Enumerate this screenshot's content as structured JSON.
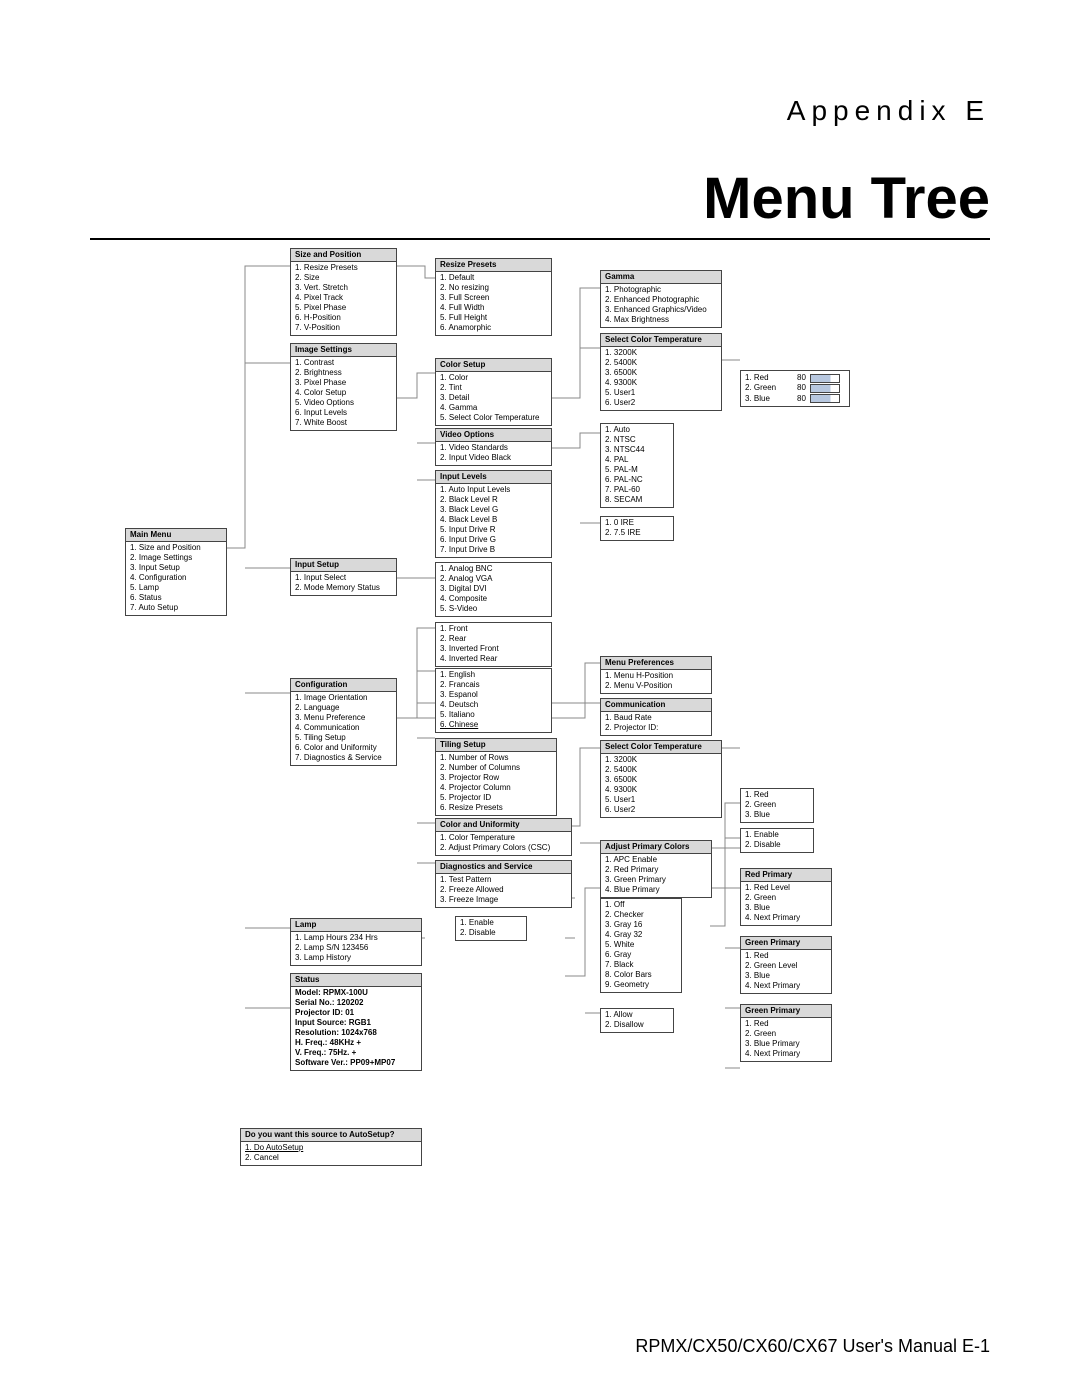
{
  "appendix": "Appendix E",
  "title": "Menu Tree",
  "footer": "RPMX/CX50/CX60/CX67 User's Manual  E-1",
  "box": {
    "main": {
      "h": "Main Menu",
      "i": [
        "1.  Size and Position",
        "2.  Image Settings",
        "3.  Input Setup",
        "4.  Configuration",
        "5.  Lamp",
        "6.  Status",
        "7.  Auto Setup"
      ]
    },
    "size": {
      "h": "Size and Position",
      "i": [
        "1.  Resize Presets",
        "2.  Size",
        "3.  Vert. Stretch",
        "4.  Pixel Track",
        "5.  Pixel Phase",
        "6.  H-Position",
        "7.  V-Position"
      ]
    },
    "resize": {
      "h": "Resize Presets",
      "i": [
        "1.  Default",
        "2.  No resizing",
        "3.  Full Screen",
        "4.  Full Width",
        "5.  Full Height",
        "6.  Anamorphic"
      ]
    },
    "gamma": {
      "h": "Gamma",
      "i": [
        "1.  Photographic",
        "2.  Enhanced Photographic",
        "3.  Enhanced Graphics/Video",
        "4.  Max Brightness"
      ]
    },
    "sct1": {
      "h": "Select Color Temperature",
      "i": [
        "1.  3200K",
        "2.  5400K",
        "3.  6500K",
        "4.  9300K",
        "5.  User1",
        "6.  User2"
      ]
    },
    "image": {
      "h": "Image Settings",
      "i": [
        "1.  Contrast",
        "2.  Brightness",
        "3.  Pixel Phase",
        "4.  Color Setup",
        "5.  Video Options",
        "6.  Input Levels",
        "7.  White Boost"
      ]
    },
    "colorsetup": {
      "h": "Color Setup",
      "i": [
        "1.  Color",
        "2.  Tint",
        "3.  Detail",
        "4.  Gamma",
        "5.  Select Color Temperature"
      ]
    },
    "video": {
      "h": "Video Options",
      "i": [
        "1.  Video Standards",
        "2.  Input Video Black"
      ]
    },
    "vidstd": {
      "i": [
        "1.  Auto",
        "2.  NTSC",
        "3.  NTSC44",
        "4.  PAL",
        "5.  PAL-M",
        "6.  PAL-NC",
        "7.  PAL-60",
        "8.  SECAM"
      ]
    },
    "ire": {
      "i": [
        "1.  0 IRE",
        "2.  7.5 IRE"
      ]
    },
    "inlvl": {
      "h": "Input Levels",
      "i": [
        "1.  Auto Input Levels",
        "2.  Black Level R",
        "3.  Black Level G",
        "4.  Black Level B",
        "5.  Input Drive R",
        "6.  Input Drive G",
        "7.  Input Drive B"
      ]
    },
    "isetup": {
      "h": "Input Setup",
      "i": [
        "1.  Input Select",
        "2.  Mode Memory Status"
      ]
    },
    "inputsel": {
      "i": [
        "1.  Analog BNC",
        "2.  Analog VGA",
        "3.  Digital DVI",
        "4.  Composite",
        "5.  S-Video"
      ]
    },
    "orient": {
      "i": [
        "1.  Front",
        "2.  Rear",
        "3.  Inverted Front",
        "4.  Inverted Rear"
      ]
    },
    "lang": {
      "i": [
        "1.  English",
        "2.  Francais",
        "3.  Espanol",
        "4.  Deutsch",
        "5.  Italiano",
        "6.  Chinese"
      ]
    },
    "config": {
      "h": "Configuration",
      "i": [
        "1.  Image Orientation",
        "2.  Language",
        "3.  Menu Preference",
        "4.  Communication",
        "5.  Tiling Setup",
        "6.  Color and Uniformity",
        "7.  Diagnostics & Service"
      ]
    },
    "menupref": {
      "h": "Menu Preferences",
      "i": [
        "1.  Menu H-Position",
        "2.  Menu V-Position"
      ]
    },
    "comm": {
      "h": "Communication",
      "i": [
        "1.  Baud Rate",
        "2.  Projector ID:"
      ]
    },
    "tiling": {
      "h": "Tiling Setup",
      "i": [
        "1.  Number of Rows",
        "2.  Number of Columns",
        "3.  Projector Row",
        "4.  Projector Column",
        "5.  Projector ID",
        "6.  Resize Presets"
      ]
    },
    "sct2": {
      "h": "Select Color Temperature",
      "i": [
        "1.  3200K",
        "2.  5400K",
        "3.  6500K",
        "4.  9300K",
        "5.  User1",
        "6.  User2"
      ]
    },
    "cau": {
      "h": "Color and Uniformity",
      "i": [
        "1.  Color Temperature",
        "2.  Adjust Primary Colors (CSC)"
      ]
    },
    "apc": {
      "h": "Adjust Primary Colors",
      "i": [
        "1.  APC Enable",
        "2.  Red Primary",
        "3.  Green Primary",
        "4.  Blue Primary"
      ]
    },
    "rgb2": {
      "i": [
        "1.  Red",
        "2.  Green",
        "3.  Blue"
      ]
    },
    "ed": {
      "i": [
        "1.  Enable",
        "2.  Disable"
      ]
    },
    "redp": {
      "h": "Red Primary",
      "i": [
        "1.  Red Level",
        "2.  Green",
        "3.  Blue",
        "4.  Next Primary"
      ]
    },
    "greenp": {
      "h": "Green Primary",
      "i": [
        "1.  Red",
        "2.  Green Level",
        "3.  Blue",
        "4.  Next Primary"
      ]
    },
    "bluep": {
      "h": "Green Primary",
      "i": [
        "1.  Red",
        "2.  Green",
        "3.  Blue Primary",
        "4.  Next Primary"
      ]
    },
    "diag": {
      "h": "Diagnostics and Service",
      "i": [
        "1.  Test Pattern",
        "2.  Freeze Allowed",
        "3.  Freeze Image"
      ]
    },
    "ed2": {
      "i": [
        "1.  Enable",
        "2.  Disable"
      ]
    },
    "test": {
      "i": [
        "1.  Off",
        "2.  Checker",
        "3.  Gray 16",
        "4.  Gray 32",
        "5.  White",
        "6.  Gray",
        "7.  Black",
        "8.  Color Bars",
        "9.  Geometry"
      ]
    },
    "allow": {
      "i": [
        "1.  Allow",
        "2.  Disallow"
      ]
    },
    "lamp": {
      "h": "Lamp",
      "i": [
        "1.  Lamp Hours       234 Hrs",
        "2.  Lamp S/N           123456",
        "3.  Lamp History"
      ]
    },
    "status": {
      "h": "Status",
      "i": [
        "Model: RPMX-100U",
        "Serial No.:  120202",
        "Projector ID: 01",
        "Input Source: RGB1",
        "Resolution: 1024x768",
        "H. Freq.: 48KHz +",
        "V. Freq.: 75Hz. +",
        "Software Ver.: PP09+MP07"
      ]
    },
    "auto": {
      "h": "Do you want this source to AutoSetup?",
      "i": [
        "1.   Do AutoSetup",
        "2.  Cancel"
      ]
    }
  },
  "sliders": {
    "rows": [
      [
        "1.  Red",
        "80"
      ],
      [
        "2.  Green",
        "80"
      ],
      [
        "3.  Blue",
        "80"
      ]
    ]
  }
}
